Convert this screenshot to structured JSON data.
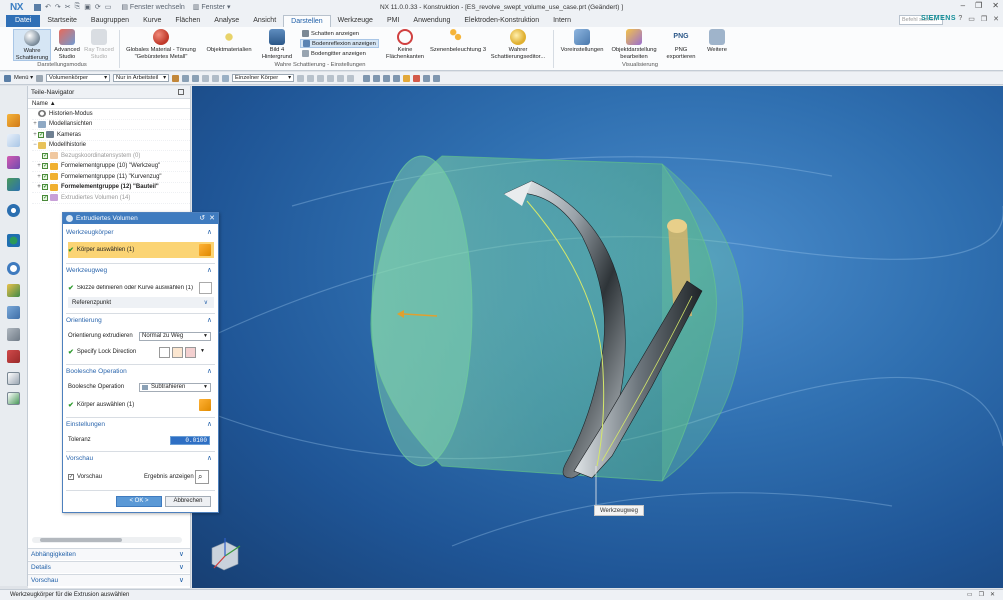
{
  "window": {
    "logo": "NX",
    "title": "NX 11.0.0.33 - Konstruktion - [ES_revolve_swept_volume_use_case.prt (Geändert) ]",
    "switch_window": "Fenster wechseln",
    "window_menu": "Fenster ▾"
  },
  "ribbon_tabs": [
    {
      "label": "Datei"
    },
    {
      "label": "Startseite"
    },
    {
      "label": "Baugruppen"
    },
    {
      "label": "Kurve"
    },
    {
      "label": "Flächen"
    },
    {
      "label": "Analyse"
    },
    {
      "label": "Ansicht"
    },
    {
      "label": "Darstellen"
    },
    {
      "label": "Werkzeuge"
    },
    {
      "label": "PMI"
    },
    {
      "label": "Anwendung"
    },
    {
      "label": "Elektroden-Konstruktion"
    },
    {
      "label": "Intern"
    }
  ],
  "search_placeholder": "Befehl suchen",
  "brand": "SIEMENS",
  "ribbon": {
    "true_shading": "Wahre Schattierung",
    "advanced_studio": "Advanced Studio",
    "ray_traced_studio": "Ray Traced Studio",
    "display_mode_group": "Darstellungsmodus",
    "global_material": "Globales Material - Tönung \"Gebürstetes Metall\"",
    "object_materials": "Objektmaterialien",
    "background_image": "Bild 4 Hintergrund",
    "show_shadows": "Schatten anzeigen",
    "show_floor_reflection": "Bodenreflexion anzeigen",
    "floor_grid": "Bodengitter anzeigen",
    "no_face_edges": "Keine Flächenkanten",
    "scene_lighting": "Szenenbeleuchtung 3",
    "true_shading_editor": "Wahrer Schattierungseditor...",
    "true_shading_settings_group": "Wahre Schattierung - Einstellungen",
    "presets": "Voreinstellungen",
    "edit_object_display": "Objektdarstellung bearbeiten",
    "png_label": "PNG",
    "png_export": "PNG exportieren",
    "more": "Weitere",
    "visualization_group": "Visualisierung"
  },
  "toolbar": {
    "menu": "Menü ▾",
    "filter_type": "Volumenkörper",
    "filter_scope": "Nur in Arbeitsteil",
    "selection_mode": "Einzelner Körper"
  },
  "navigator": {
    "title": "Teile-Navigator",
    "col_name": "Name",
    "items": [
      {
        "label": "Historien-Modus"
      },
      {
        "label": "Modellansichten"
      },
      {
        "label": "Kameras"
      },
      {
        "label": "Modellhistorie"
      },
      {
        "label": "Bezugskoordinatensystem (0)"
      },
      {
        "label": "Formelementgruppe (10) \"Werkzeug\""
      },
      {
        "label": "Formelementgruppe (11) \"Kurvenzug\""
      },
      {
        "label": "Formelementgruppe (12) \"Bauteil\""
      },
      {
        "label": "Extrudiertes Volumen (14)"
      }
    ],
    "sections": [
      {
        "label": "Abhängigkeiten"
      },
      {
        "label": "Details"
      },
      {
        "label": "Vorschau"
      }
    ]
  },
  "dialog": {
    "title": "Extrudiertes Volumen",
    "tool_body": {
      "header": "Werkzeugkörper",
      "select_body": "Körper auswählen (1)"
    },
    "tool_path": {
      "header": "Werkzeugweg",
      "sketch_or_curve": "Skizze definieren oder Kurve auswählen (1)",
      "reference_point": "Referenzpunkt"
    },
    "orientation": {
      "header": "Orientierung",
      "extrude_orientation_label": "Orientierung extrudieren",
      "extrude_orientation_value": "Normal zu Weg",
      "lock_direction": "Specify Lock Direction"
    },
    "boolean": {
      "header": "Boolesche Operation",
      "operation_label": "Boolesche Operation",
      "operation_value": "Subtrahieren",
      "select_body": "Körper auswählen (1)"
    },
    "settings": {
      "header": "Einstellungen",
      "tolerance_label": "Toleranz",
      "tolerance_value": "0.0100"
    },
    "preview": {
      "header": "Vorschau",
      "preview_label": "Vorschau",
      "show_result": "Ergebnis anzeigen"
    },
    "ok": "< OK >",
    "cancel": "Abbrechen"
  },
  "viewport": {
    "callout": "Werkzeugweg"
  },
  "status": {
    "message": "Werkzeugkörper für die Extrusion auswählen"
  }
}
